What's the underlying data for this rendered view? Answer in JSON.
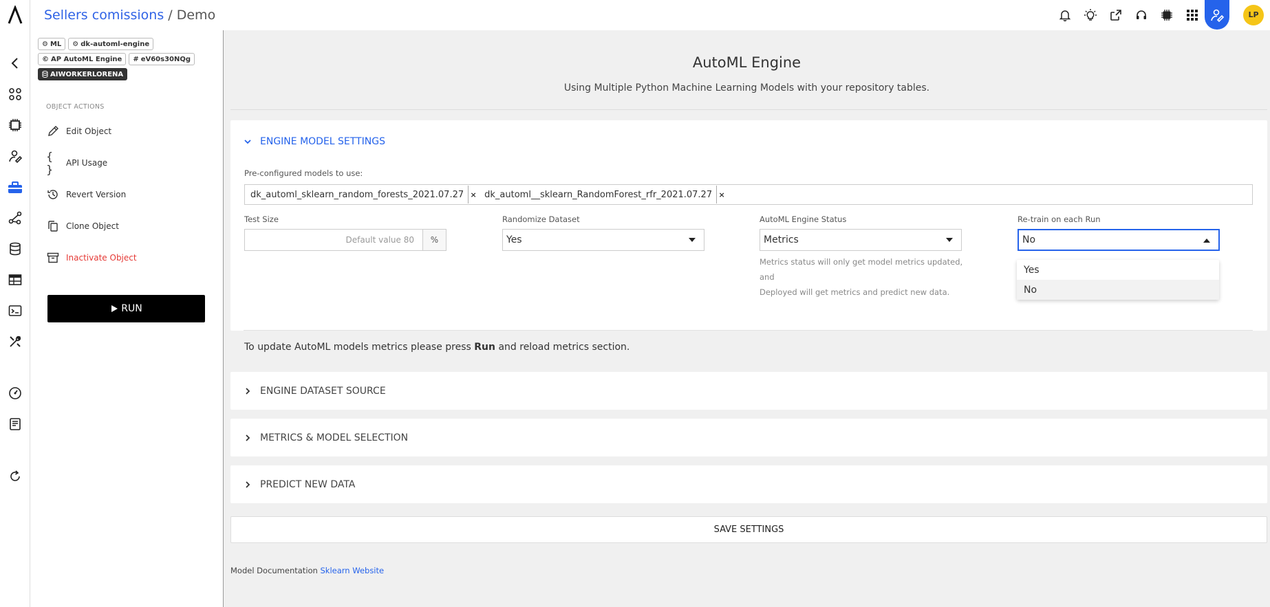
{
  "breadcrumb": {
    "link": "Sellers comissions",
    "separator": " / ",
    "current": "Demo"
  },
  "header": {
    "avatar_initials": "LP"
  },
  "tags": {
    "ml": "ML",
    "engine": "dk-automl-engine",
    "ap_engine": "AP AutoML Engine",
    "id": "eV60s30NQg",
    "worker": "AIWORKERLORENA"
  },
  "sidebar": {
    "section_title": "OBJECT ACTIONS",
    "actions": [
      {
        "label": "Edit Object"
      },
      {
        "label": "API Usage"
      },
      {
        "label": "Revert Version"
      },
      {
        "label": "Clone Object"
      },
      {
        "label": "Inactivate Object"
      }
    ],
    "run_label": "RUN"
  },
  "page": {
    "title": "AutoML Engine",
    "subtitle": "Using Multiple Python Machine Learning Models with your repository tables."
  },
  "engine_settings": {
    "title": "ENGINE MODEL SETTINGS",
    "preconfig_label": "Pre-configured models to use:",
    "models": [
      "dk_automl_sklearn_random_forests_2021.07.27",
      "dk_automl__sklearn_RandomForest_rfr_2021.07.27"
    ],
    "chip_remove": "×",
    "test_size": {
      "label": "Test Size",
      "placeholder": "Default value 80",
      "unit": "%"
    },
    "randomize": {
      "label": "Randomize Dataset",
      "value": "Yes"
    },
    "status": {
      "label": "AutoML Engine Status",
      "value": "Metrics",
      "help_line1": "Metrics status will only get model metrics updated, and",
      "help_line2": "Deployed will get metrics and predict new data."
    },
    "retrain": {
      "label": "Re-train on each Run",
      "value": "No",
      "options": [
        "Yes",
        "No"
      ]
    },
    "note_before": "To update AutoML models metrics please press ",
    "note_bold": "Run",
    "note_after": " and reload metrics section."
  },
  "sections": [
    {
      "title": "ENGINE DATASET SOURCE"
    },
    {
      "title": "METRICS & MODEL SELECTION"
    },
    {
      "title": "PREDICT NEW DATA"
    }
  ],
  "save_label": "SAVE SETTINGS",
  "footer": {
    "text": "Model Documentation ",
    "link": "Sklearn Website"
  },
  "colors": {
    "accent": "#2563eb",
    "danger": "#e53935",
    "avatar": "#f5c518"
  }
}
